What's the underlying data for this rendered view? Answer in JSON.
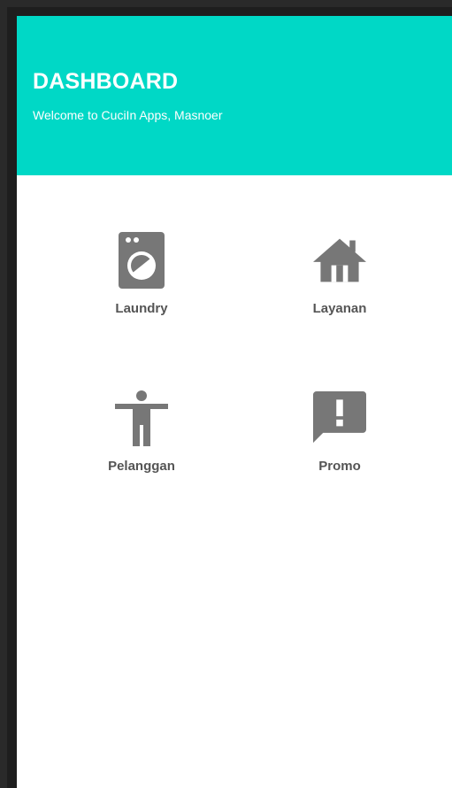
{
  "header": {
    "title": "DASHBOARD",
    "subtitle": "Welcome to CuciIn Apps, Masnoer"
  },
  "menu": [
    {
      "label": "Laundry",
      "icon": "washing-machine-icon"
    },
    {
      "label": "Layanan",
      "icon": "house-icon"
    },
    {
      "label": "Pelanggan",
      "icon": "accessibility-person-icon"
    },
    {
      "label": "Promo",
      "icon": "feedback-exclamation-icon"
    }
  ],
  "colors": {
    "header_bg": "#00d8c6",
    "icon_gray": "#777777",
    "label_gray": "#555555"
  }
}
